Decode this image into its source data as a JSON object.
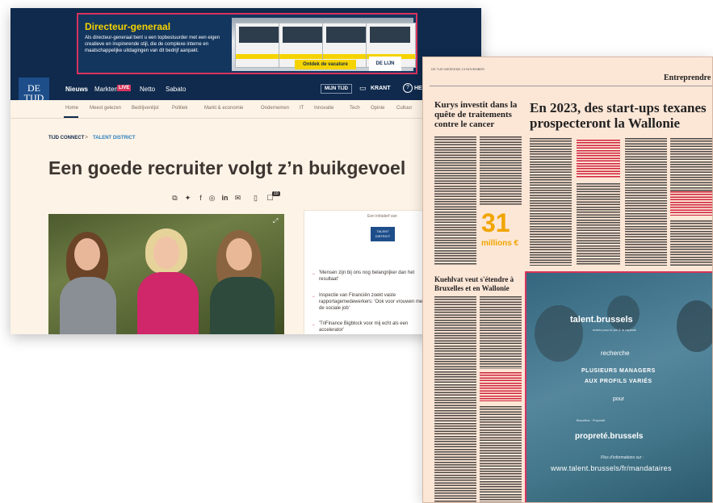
{
  "site": {
    "ad": {
      "title": "Directeur-generaal",
      "text": "Als directeur-generaal bent u een topbestuurder met een eigen creatieve en inspirerende stijl, die de complexe interne en maatschappelijke uitdagingen van dit bedrijf aanpakt.",
      "cta": "Ontdek de vacature",
      "advertiser": "DE LIJN"
    },
    "logo": "DE TIJD",
    "nav": {
      "items": [
        "Nieuws",
        "Markten",
        "Netto",
        "Sabato"
      ],
      "live_badge": "LIVE",
      "mijn_tijd": "MIJN TIJD",
      "krant": "KRANT",
      "help": "HEL"
    },
    "subnav": [
      "Home",
      "Meest gelezen",
      "Bedrijvenlijst",
      "Politiek",
      "Markt & economie",
      "Ondernemen",
      "IT",
      "Innovatie",
      "Tech",
      "Opinie",
      "Cultuur"
    ],
    "breadcrumb": [
      "TIJD CONNECT",
      "TALENT DISTRICT"
    ],
    "breadcrumb_sep": ">",
    "headline": "Een goede recruiter volgt z’n buikgevoel",
    "comment_count": "10",
    "sidebox": {
      "label": "Een initiatief van",
      "logo": "TALENT DISTRICT",
      "links": [
        "'Mensen zijn bij ons nog belangrijker dan het resultaat'",
        "Inspectie van Financiën zoekt vaste rapportagemedewerkers: 'Ook voor vrouwen met dit de sociale job'",
        "'TriFinance Bigblock voor mij echt als een accelerator'"
      ]
    }
  },
  "paper": {
    "top_line": "DE TIJD WEEKEND 13 NOVEMBER",
    "section": "Entreprendre",
    "headlines": [
      "Kurys investit dans la quête de traitements contre le cancer",
      "En 2023, des start-ups texanes prospecteront la Wallonie",
      "Kuehlvat veut s'étendre à Bruxelles et en Wallonie"
    ],
    "big_number": "31",
    "big_unit": "millions €",
    "talent_ad": {
      "logo": "talent.brussels",
      "tagline": "entrez pour le job & la capitale",
      "recherche": "recherche",
      "line1": "PLUSIEURS MANAGERS",
      "line2": "AUX PROFILS VARIÉS",
      "pour": "pour",
      "bruxelles_label": "Bruxelles · Propreté",
      "proprete": "propreté.brussels",
      "info_label": "Plus d'informations sur :",
      "url": "www.talent.brussels/fr/mandataires"
    }
  },
  "colors": {
    "navy": "#0f2a4d",
    "accent_red": "#d8335c",
    "ad_yellow": "#f5d300",
    "page_bg": "#fdf3e6",
    "paper_bg": "#fce6d6",
    "number_orange": "#f0a500"
  }
}
